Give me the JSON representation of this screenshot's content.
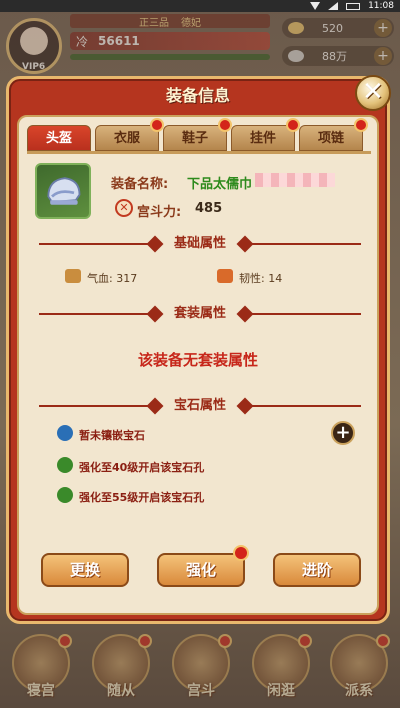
{
  "status_bar": {
    "time": "11:08"
  },
  "hud": {
    "rank": "正三品",
    "title": "德妃",
    "player_name": "冷",
    "power": "56611",
    "vip": "VIP6",
    "resources": [
      {
        "icon": "coin-icon",
        "value": "520"
      },
      {
        "icon": "silver-icon",
        "value": "88万"
      }
    ]
  },
  "dialog": {
    "title": "装备信息",
    "close_label": "✕",
    "tabs": [
      {
        "label": "头盔",
        "active": true
      },
      {
        "label": "衣服"
      },
      {
        "label": "鞋子"
      },
      {
        "label": "挂件"
      },
      {
        "label": "项链"
      }
    ],
    "item": {
      "name_label": "装备名称:",
      "name_value": "下品太儒巾",
      "power_label": "宫斗力:",
      "power_value": "485"
    },
    "sections": {
      "basic": "基础属性",
      "set": "套装属性",
      "gem": "宝石属性"
    },
    "basic_attrs": [
      {
        "label": "气血: 317"
      },
      {
        "label": "韧性: 14"
      }
    ],
    "set_text": "该装备无套装属性",
    "gems": [
      {
        "label": "暂未镶嵌宝石"
      },
      {
        "label": "强化至40级开启该宝石孔"
      },
      {
        "label": "强化至55级开启该宝石孔"
      }
    ],
    "actions": [
      {
        "label": "更换"
      },
      {
        "label": "强化"
      },
      {
        "label": "进阶"
      }
    ]
  },
  "bottom_nav": [
    {
      "label": "寝宫"
    },
    {
      "label": "随从"
    },
    {
      "label": "宫斗"
    },
    {
      "label": "闲逛"
    },
    {
      "label": "派系"
    }
  ],
  "colors": {
    "dialog_red": "#b5351f",
    "panel_cream": "#f2e6cf",
    "accent_gold": "#e9b86d",
    "green_text": "#2d8a1c",
    "red_text": "#c7271b"
  }
}
